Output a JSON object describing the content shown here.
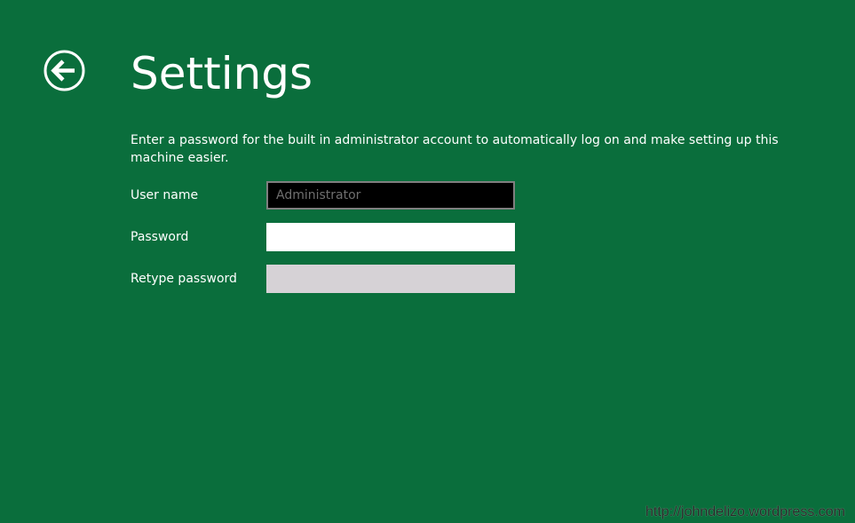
{
  "header": {
    "back_icon": "back-arrow-circle-icon",
    "title": "Settings"
  },
  "description": "Enter a password for the built in administrator account to automatically log on and make setting up this machine easier.",
  "form": {
    "username": {
      "label": "User name",
      "value": "Administrator"
    },
    "password": {
      "label": "Password",
      "value": ""
    },
    "retype_password": {
      "label": "Retype password",
      "value": ""
    }
  },
  "watermark": "http://johndelizo.wordpress.com",
  "colors": {
    "background": "#0a6e3c",
    "text": "#ffffff",
    "username_field_bg": "#000000",
    "password_field_bg": "#ffffff",
    "retype_field_bg": "#d6d2d6"
  }
}
